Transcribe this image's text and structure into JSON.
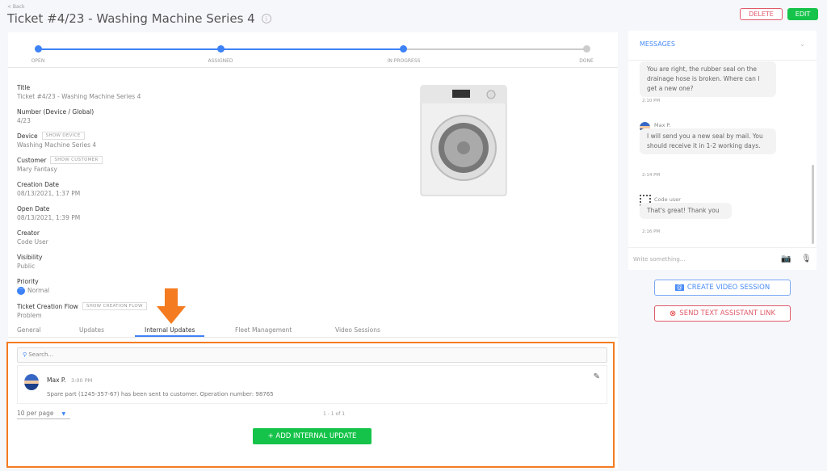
{
  "header": {
    "back": "< Back",
    "title": "Ticket #4/23 - Washing Machine Series 4",
    "delete": "DELETE",
    "edit": "EDIT"
  },
  "progress": {
    "steps": [
      "OPEN",
      "ASSIGNED",
      "IN PROGRESS",
      "DONE"
    ],
    "current": "IN PROGRESS"
  },
  "fields": [
    {
      "label": "Title",
      "value": "Ticket #4/23 - Washing Machine Series 4"
    },
    {
      "label": "Number (Device / Global)",
      "value": "4/23"
    },
    {
      "label": "Device",
      "value": "Washing Machine Series 4",
      "button": "SHOW DEVICE"
    },
    {
      "label": "Customer",
      "value": "Mary Fantasy",
      "button": "SHOW CUSTOMER"
    },
    {
      "label": "Creation Date",
      "value": "08/13/2021, 1:37 PM"
    },
    {
      "label": "Open Date",
      "value": "08/13/2021, 1:39 PM"
    },
    {
      "label": "Creator",
      "value": "Code User"
    },
    {
      "label": "Visibility",
      "value": "Public"
    },
    {
      "label": "Priority",
      "value": "Normal"
    },
    {
      "label": "Ticket Creation Flow",
      "value": "Problem",
      "button": "SHOW CREATION FLOW"
    }
  ],
  "tabs": [
    "General",
    "Updates",
    "Internal Updates",
    "Fleet Management",
    "Video Sessions"
  ],
  "active_tab": "Internal Updates",
  "internal": {
    "search_placeholder": "Search...",
    "update": {
      "author": "Max P.",
      "time": "3:00 PM",
      "text": "Spare part (1245-357-67) has been sent to customer. Operation number: 98765"
    },
    "per_page": "10 per page",
    "count": "1 - 1 of 1",
    "add": "+ ADD INTERNAL UPDATE"
  },
  "messages": {
    "title": "MESSAGES",
    "items": [
      {
        "author": "",
        "text": "You are right, the rubber seal on the drainage hose is broken. Where can I get a new one?",
        "time": "2:10 PM"
      },
      {
        "author": "Max P.",
        "text": "I will send you a new seal by mail. You should receive it in 1-2 working days.",
        "time": "2:14 PM"
      },
      {
        "author": "Code user",
        "text": "That's great! Thank you",
        "time": "2:16 PM"
      }
    ],
    "placeholder": "Write something...",
    "video": "CREATE VIDEO SESSION",
    "assistant": "SEND TEXT ASSISTANT LINK"
  },
  "colors": {
    "accent": "#3d82f6",
    "success": "#16c34a",
    "danger": "#e05a6a",
    "highlight": "#f47b20"
  }
}
